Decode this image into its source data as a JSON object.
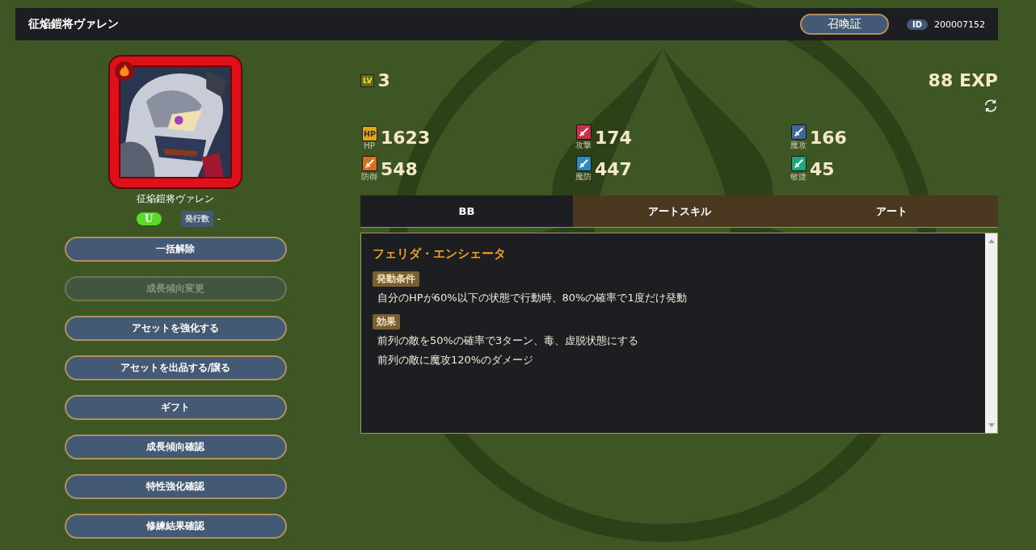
{
  "header": {
    "title": "征焔鎧将ヴァレン",
    "summon_button": "召喚証",
    "id_label": "ID",
    "id_value": "200007152"
  },
  "character": {
    "name": "征焔鎧将ヴァレン",
    "rarity": "U",
    "issue_label": "発行数",
    "issue_value": "-"
  },
  "actions": [
    {
      "label": "一括解除",
      "disabled": false
    },
    {
      "label": "成長傾向変更",
      "disabled": true
    },
    {
      "label": "アセットを強化する",
      "disabled": false
    },
    {
      "label": "アセットを出品する/譲る",
      "disabled": false
    },
    {
      "label": "ギフト",
      "disabled": false
    },
    {
      "label": "成長傾向確認",
      "disabled": false
    },
    {
      "label": "特性強化確認",
      "disabled": false
    },
    {
      "label": "修練結果確認",
      "disabled": false
    }
  ],
  "level": {
    "badge": "LV",
    "value": "3"
  },
  "exp": "88 EXP",
  "stats": [
    {
      "kind": "hp",
      "icon_text": "HP",
      "label": "HP",
      "value": "1623"
    },
    {
      "kind": "attack",
      "label": "攻撃",
      "value": "174"
    },
    {
      "kind": "magic_attack",
      "label": "魔攻",
      "value": "166"
    },
    {
      "kind": "defense",
      "label": "防御",
      "value": "548"
    },
    {
      "kind": "magic_defense",
      "label": "魔防",
      "value": "447"
    },
    {
      "kind": "agility",
      "label": "敏捷",
      "value": "45"
    }
  ],
  "tabs": [
    {
      "label": "BB",
      "selected": true
    },
    {
      "label": "アートスキル",
      "selected": false
    },
    {
      "label": "アート",
      "selected": false
    }
  ],
  "skill": {
    "name": "フェリダ・エンシェータ",
    "sections": [
      {
        "heading": "発動条件",
        "lines": [
          "自分のHPが60%以下の状態で行動時、80%の確率で1度だけ発動"
        ]
      },
      {
        "heading": "効果",
        "lines": [
          "前列の敵を50%の確率で3ターン、毒、虚脱状態にする",
          "前列の敵に魔攻120%のダメージ"
        ]
      }
    ]
  }
}
